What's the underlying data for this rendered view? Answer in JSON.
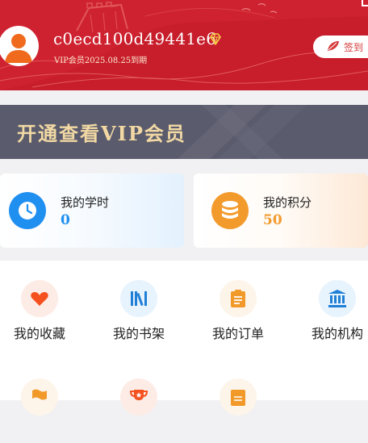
{
  "profile": {
    "username": "c0ecd100d49441e6",
    "vip_expire": "VIP会员2025.08.25到期",
    "signin_label": "签到"
  },
  "vip_banner": {
    "title": "开通查看VIP会员"
  },
  "stats": [
    {
      "label": "我的学时",
      "value": "0"
    },
    {
      "label": "我的积分",
      "value": "50"
    }
  ],
  "menu": [
    {
      "label": "我的收藏",
      "icon": "heart-icon"
    },
    {
      "label": "我的书架",
      "icon": "bookshelf-icon"
    },
    {
      "label": "我的订单",
      "icon": "order-clipboard-icon"
    },
    {
      "label": "我的机构",
      "icon": "institution-icon"
    }
  ],
  "menu_row2_icons": [
    "flag-icon",
    "trophy-icon",
    "score-sheet-icon"
  ],
  "colors": {
    "header_red": "#cf2230",
    "vip_banner_bg": "#5a5b6c",
    "vip_gold": "#f2d9a4",
    "study_blue": "#1f8ff0",
    "points_orange": "#f39a2d"
  }
}
